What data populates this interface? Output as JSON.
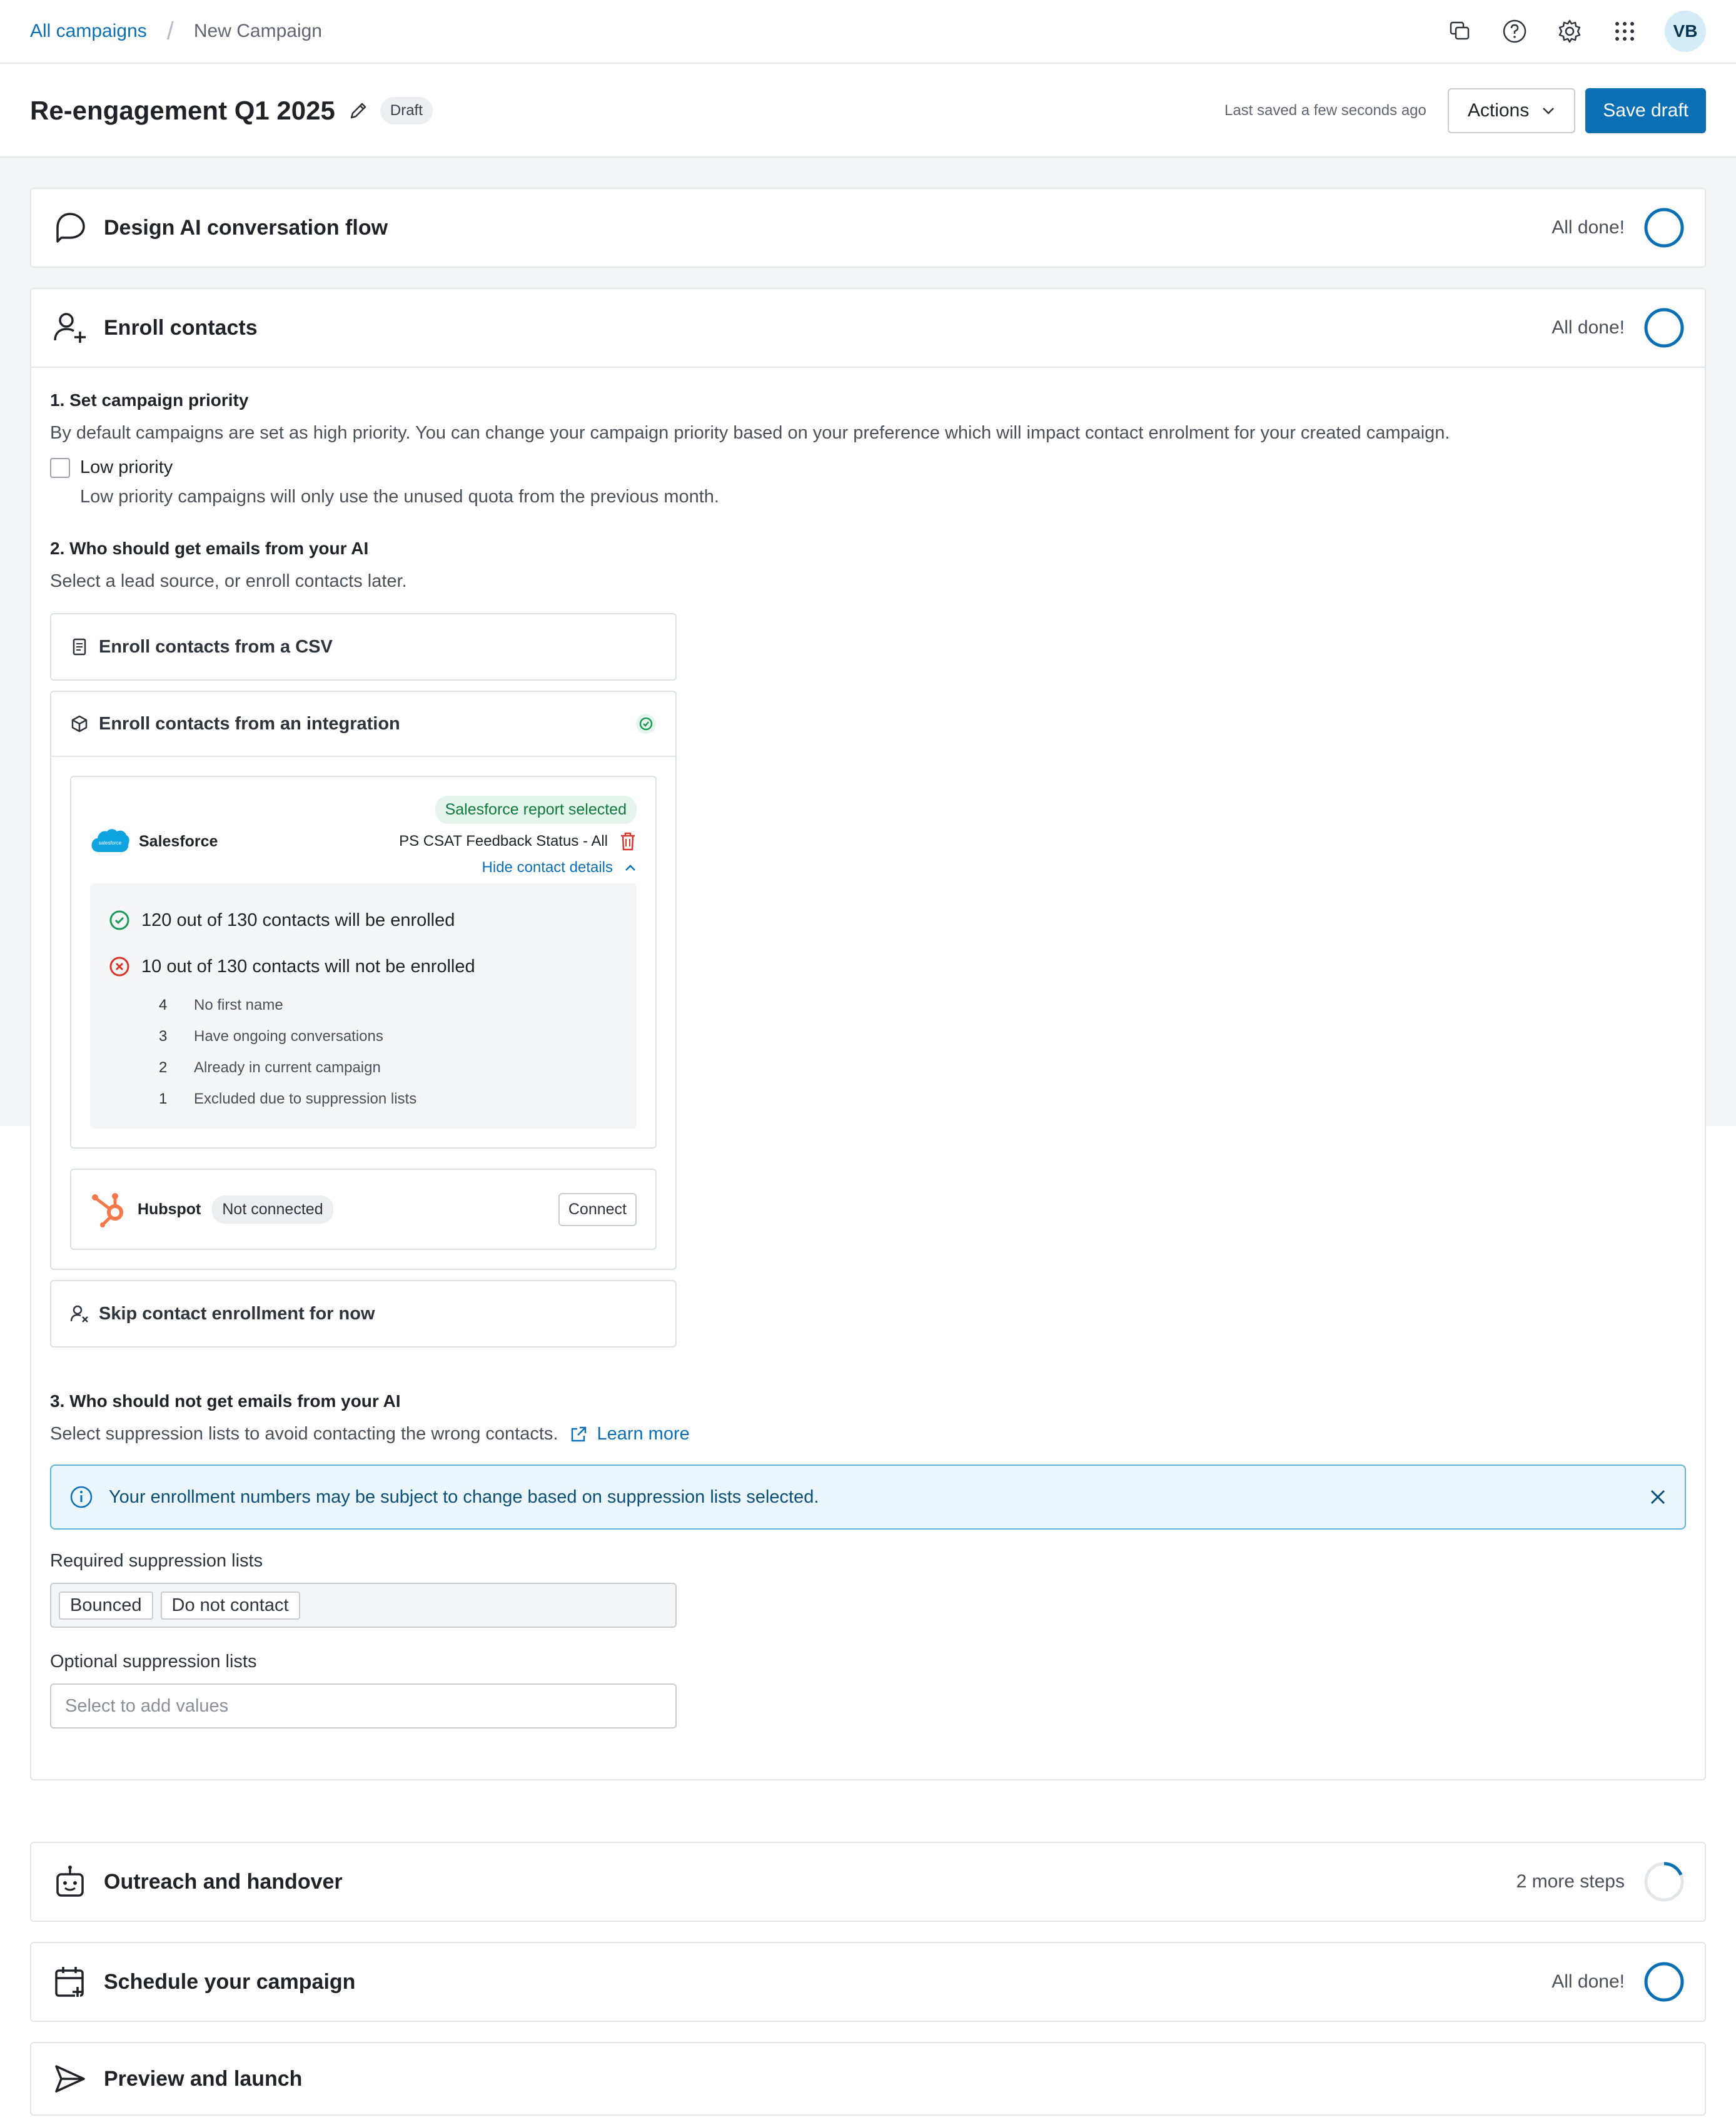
{
  "breadcrumb": {
    "parent": "All campaigns",
    "current": "New Campaign"
  },
  "nav": {
    "avatar_initials": "VB",
    "icons": [
      "chat-icon",
      "help-icon",
      "settings-icon",
      "apps-grid-icon"
    ]
  },
  "header": {
    "title": "Re-engagement Q1 2025",
    "status_badge": "Draft",
    "last_saved": "Last saved a few seconds ago",
    "actions_label": "Actions",
    "save_label": "Save draft"
  },
  "colors": {
    "accent": "#0a6fb5",
    "success": "#1e9a57",
    "danger": "#d9342b"
  },
  "steps": {
    "design": {
      "title": "Design AI conversation flow",
      "status": "All done!"
    },
    "enroll": {
      "title": "Enroll contacts",
      "status": "All done!"
    },
    "outreach": {
      "title": "Outreach and handover",
      "status": "2 more steps"
    },
    "schedule": {
      "title": "Schedule your campaign",
      "status": "All done!"
    },
    "preview": {
      "title": "Preview and launch"
    }
  },
  "enroll": {
    "priority": {
      "title": "1. Set campaign priority",
      "description": "By default campaigns are set as high priority. You can change your campaign priority based on your preference which will impact contact enrolment for your created campaign.",
      "checkbox_label": "Low priority",
      "checkbox_help": "Low priority campaigns will only use the unused quota from the previous month.",
      "checked": false
    },
    "who": {
      "title": "2. Who should get emails from your AI",
      "description": "Select a lead source, or enroll contacts later.",
      "csv_label": "Enroll contacts from a CSV",
      "integration_label": "Enroll contacts from an integration",
      "skip_label": "Skip contact enrollment for now",
      "salesforce": {
        "name": "Salesforce",
        "logo_text": "salesforce",
        "tag": "Salesforce report selected",
        "report": "PS CSAT Feedback Status - All",
        "toggle_label": "Hide contact details",
        "enrolled": "120 out of 130 contacts will be enrolled",
        "not_enrolled": "10 out of 130 contacts will not be enrolled",
        "reasons": [
          {
            "count": "4",
            "label": "No first name"
          },
          {
            "count": "3",
            "label": "Have ongoing conversations"
          },
          {
            "count": "2",
            "label": "Already in current campaign"
          },
          {
            "count": "1",
            "label": "Excluded due to suppression lists"
          }
        ]
      },
      "hubspot": {
        "name": "Hubspot",
        "status": "Not connected",
        "connect_label": "Connect"
      }
    },
    "suppression": {
      "title": "3. Who should not get emails from your AI",
      "description": "Select suppression lists to avoid contacting the wrong contacts.",
      "learn_more": "Learn more",
      "banner": "Your enrollment numbers may be subject to change based on suppression lists selected.",
      "required_label": "Required suppression lists",
      "required_values": [
        "Bounced",
        "Do not contact"
      ],
      "optional_label": "Optional suppression lists",
      "optional_placeholder": "Select to add values"
    }
  }
}
